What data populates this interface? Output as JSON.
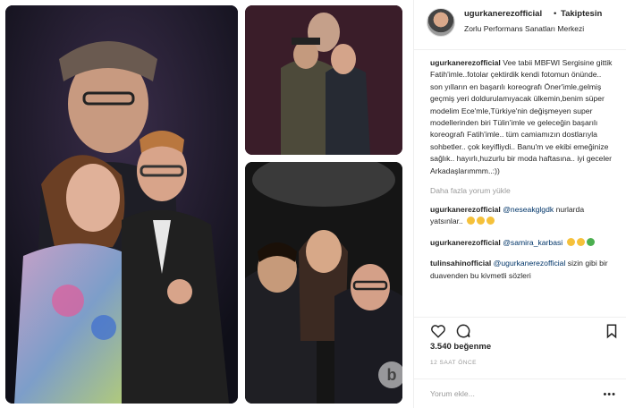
{
  "post": {
    "username": "ugurkanerezofficial",
    "separator": "•",
    "follow_label": "Takiptesin",
    "location": "Zorlu Performans Sanatları Merkezi",
    "caption": "Vee tabii MBFWI Sergisine gittik Fatih'imle..fotolar çektirdik kendi fotomun önünde.. son yılların en başarılı koreografı Öner'imle,gelmiş geçmiş yeri doldurulamıyacak ülkemin,benim süper modelim Ece'mle,Türkiye'nin değişmeyen super modellerinden biri Tülin'imle ve geleceğin başarılı koreografı Fatih'imle.. tüm camiamızın dostlarıyla sohbetler.. çok keyifliydi.. Banu'm ve ekibi emeğinize sağlık.. hayırlı,huzurlu bir moda haftasına.. iyi geceler Arkadaşlarımmm..:))",
    "load_more": "Daha fazla yorum yükle",
    "likes": "3.540 beğenme",
    "time": "12 SAAT ÖNCE",
    "add_comment_placeholder": "Yorum ekle...",
    "more": "•••"
  },
  "comments": [
    {
      "user": "ugurkanerezofficial",
      "mention": "@neseakglgdk",
      "text": "nurlarda yatsınlar..",
      "emoji_count": 3,
      "emoji_colors": [
        "#f5c13b",
        "#f5c13b",
        "#f5c13b"
      ]
    },
    {
      "user": "ugurkanerezofficial",
      "mention": "@samira_karbasi",
      "text": "",
      "emoji_count": 3,
      "emoji_colors": [
        "#f5c13b",
        "#f5c13b",
        "#4caf50"
      ]
    },
    {
      "user": "tulinsahinofficial",
      "mention": "@ugurkanerezofficial",
      "text": "sizin gibi bir duavenden bu kivmetli sözleri"
    }
  ],
  "icons": [
    "heart-icon",
    "comment-icon",
    "bookmark-icon"
  ],
  "watermark": "b"
}
